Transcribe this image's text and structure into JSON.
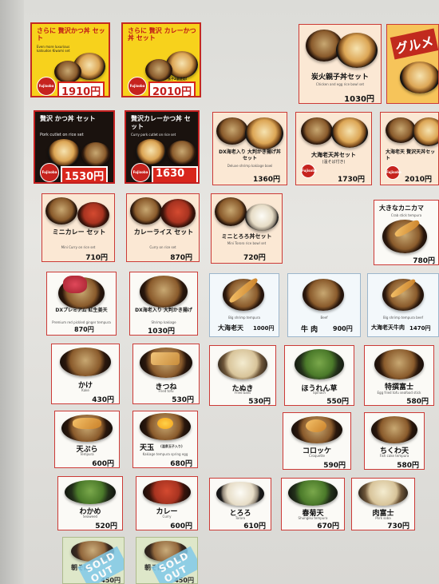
{
  "specials": [
    {
      "name": "さらに 贅沢かつ丼 セット",
      "sub": "Even more luxurious katsudon Kiwami set",
      "price": "1910円",
      "badge": "極"
    },
    {
      "name": "さらに 贅沢 カレーかつ丼 セット",
      "sub": "Even more luxurious curry katsudon Kiwami",
      "price": "2010円",
      "tag": "玉子2個使用!"
    },
    {
      "name": "贅沢 かつ丼 セット",
      "sub": "Pork cutlet on rice set",
      "price": "1530円"
    },
    {
      "name": "贅沢カレーかつ丼 セット",
      "sub": "Curry pork cutlet on rice set",
      "price": "1630円"
    }
  ],
  "logo_text": "Fujisoba",
  "top_right": {
    "banner": "グルメ",
    "name": "炭火親子丼セット",
    "sub": "Chicken and egg rice bowl set",
    "price": "1030円"
  },
  "row2": [
    {
      "name": "DX海老入り 大判かき揚げ丼セット",
      "sub": "Deluxe shrimp kakiage bowl",
      "price": "1360円"
    },
    {
      "name": "大海老天丼セット",
      "sub": "(温そば付き)",
      "price": "1730円"
    },
    {
      "name": "大海老天 贅沢天丼セット",
      "price": "2010円"
    }
  ],
  "row3": [
    {
      "name": "ミニカレー セット",
      "sub": "Mini Curry on rice set",
      "price": "710円"
    },
    {
      "name": "カレーライス セット",
      "sub": "Curry on rice set",
      "price": "870円"
    },
    {
      "name": "ミニとろろ丼セット",
      "sub": "Mini Tororo rice bowl set",
      "price": "720円"
    },
    {
      "name": "大きなカニカマ",
      "sub": "Crab stick tempura",
      "price": "780円"
    }
  ],
  "row4": [
    {
      "name": "DXプレミアム 紅生姜天",
      "sub": "Premium red pickled ginger tempura",
      "price": "870円"
    },
    {
      "name": "DX海老入り 大判かき揚げ",
      "sub": "Shrimp kakiage",
      "price": "1030円"
    },
    {
      "name": "大海老天",
      "sub": "Big shrimp tempura",
      "price": "1000円"
    },
    {
      "name": "牛 肉",
      "sub": "Beef",
      "price": "900円"
    },
    {
      "name": "大海老天牛肉",
      "sub": "Big shrimp tempura beef",
      "price": "1470円"
    }
  ],
  "row5": [
    {
      "name": "かけ",
      "sub": "Kake",
      "price": "430円"
    },
    {
      "name": "きつね",
      "sub": "Fried tofu",
      "price": "530円"
    },
    {
      "name": "たぬき",
      "sub": "Fried balls",
      "price": "530円"
    },
    {
      "name": "ほうれん草",
      "sub": "Spinach",
      "price": "550円"
    },
    {
      "name": "特撰富士",
      "sub": "Egg fried tofu seafood stick",
      "price": "580円"
    }
  ],
  "row6": [
    {
      "name": "天ぷら",
      "sub": "Tempura",
      "price": "600円"
    },
    {
      "name": "天玉",
      "tag": "(温泉玉子入り)",
      "sub": "Kakiage tempura spring egg",
      "price": "680円"
    },
    {
      "name": "コロッケ",
      "sub": "Croquette",
      "price": "590円"
    },
    {
      "name": "ちくわ天",
      "sub": "Fish cake tempura",
      "price": "580円"
    }
  ],
  "row7": [
    {
      "name": "わかめ",
      "sub": "Seaweed",
      "price": "520円"
    },
    {
      "name": "カレー",
      "sub": "Curry",
      "price": "600円"
    },
    {
      "name": "とろろ",
      "sub": "Tororo",
      "price": "610円"
    },
    {
      "name": "春菊天",
      "sub": "Shungiku tempura",
      "price": "670円"
    },
    {
      "name": "肉富士",
      "sub": "Pork soba",
      "price": "730円"
    }
  ],
  "row8": [
    {
      "name": "朝そば",
      "price": "450円",
      "sold": "SOLD OUT"
    },
    {
      "name": "朝そば・",
      "price": "450円",
      "sold": "SOLD OUT"
    }
  ]
}
